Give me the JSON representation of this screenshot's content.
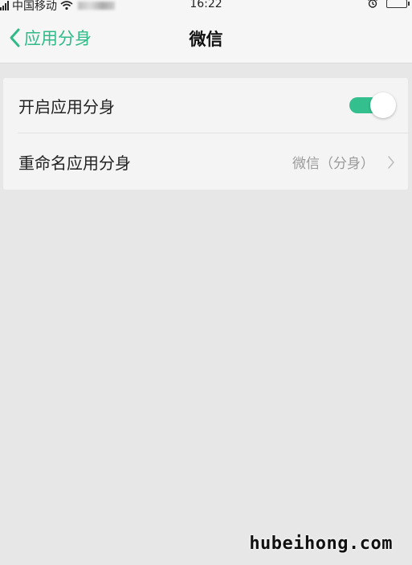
{
  "status_bar": {
    "carrier": "中国移动",
    "time": "16:22"
  },
  "nav": {
    "back_label": "应用分身",
    "title": "微信"
  },
  "settings": {
    "enable_clone": {
      "label": "开启应用分身",
      "enabled": true
    },
    "rename_clone": {
      "label": "重命名应用分身",
      "value": "微信（分身）"
    }
  },
  "colors": {
    "accent": "#33c08e",
    "background": "#e7e7e7",
    "card": "#f4f4f4"
  },
  "watermark": "hubeihong.com"
}
